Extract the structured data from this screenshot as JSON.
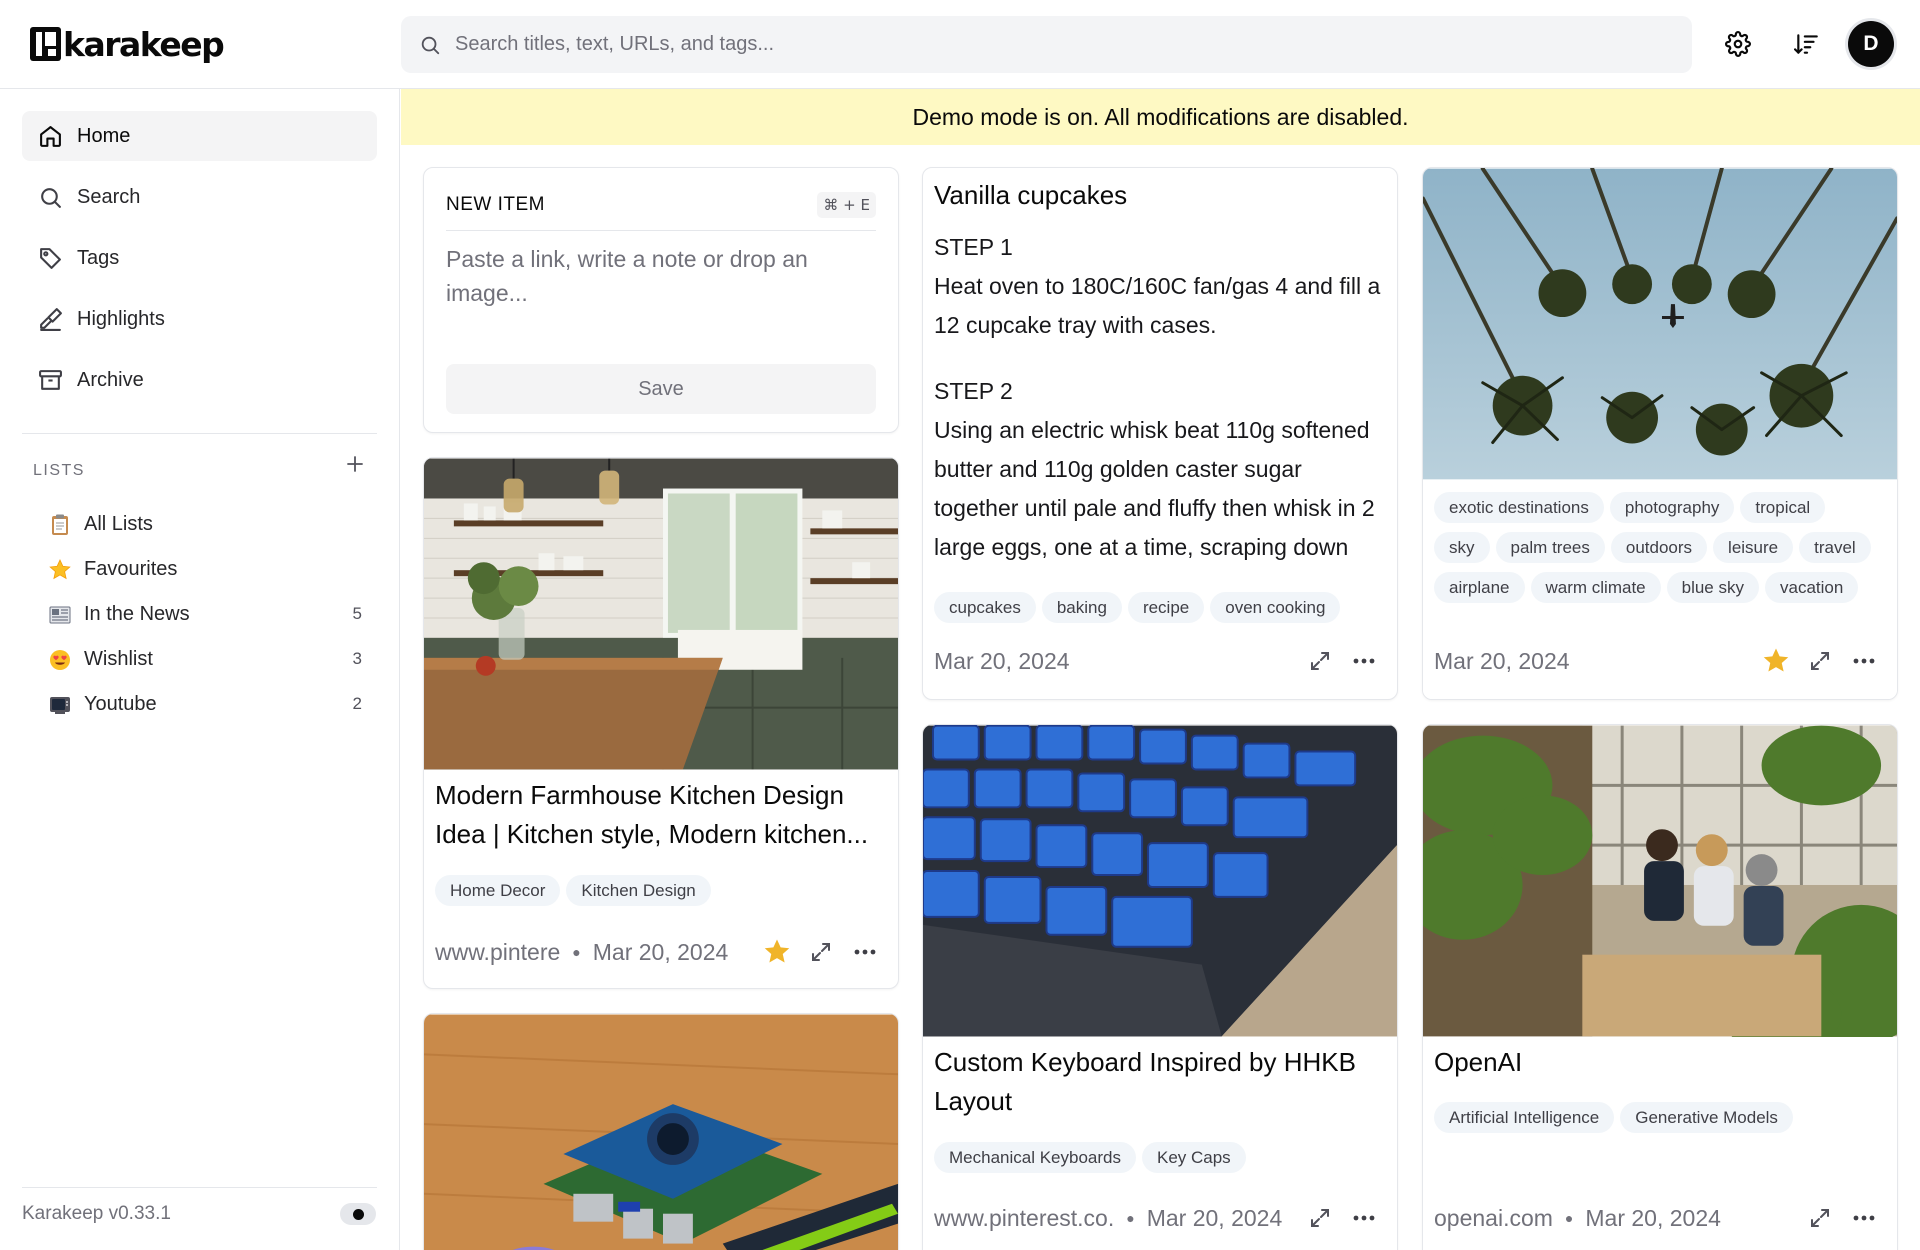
{
  "app": {
    "name": "karakeep"
  },
  "search": {
    "placeholder": "Search titles, text, URLs, and tags..."
  },
  "header": {
    "avatar_initial": "D"
  },
  "sidebar": {
    "nav": [
      {
        "label": "Home",
        "icon": "home-icon",
        "active": true
      },
      {
        "label": "Search",
        "icon": "search-icon"
      },
      {
        "label": "Tags",
        "icon": "tag-icon"
      },
      {
        "label": "Highlights",
        "icon": "highlighter-icon"
      },
      {
        "label": "Archive",
        "icon": "archive-icon"
      }
    ],
    "lists_heading": "LISTS",
    "lists": [
      {
        "emoji": "📋",
        "label": "All Lists",
        "count": ""
      },
      {
        "emoji": "⭐",
        "label": "Favourites",
        "count": ""
      },
      {
        "emoji": "📰",
        "label": "In the News",
        "count": "5"
      },
      {
        "emoji": "😍",
        "label": "Wishlist",
        "count": "3"
      },
      {
        "emoji": "📺",
        "label": "Youtube",
        "count": "2"
      }
    ],
    "version": "Karakeep v0.33.1"
  },
  "banner": {
    "text": "Demo mode is on. All modifications are disabled."
  },
  "new_item": {
    "heading": "NEW ITEM",
    "shortcut": "⌘ + E",
    "placeholder": "Paste a link, write a note or drop an image...",
    "save_label": "Save"
  },
  "cards": {
    "note": {
      "title": "Vanilla cupcakes",
      "step1_heading": "STEP 1",
      "step1_text": "Heat oven to 180C/160C fan/gas 4 and fill a 12 cupcake tray with cases.",
      "step2_heading": "STEP 2",
      "step2_text": "Using an electric whisk beat 110g softened butter and 110g golden caster sugar together until pale and fluffy then whisk in 2 large eggs, one at a time, scraping down",
      "tags": [
        "cupcakes",
        "baking",
        "recipe",
        "oven cooking"
      ],
      "date": "Mar 20, 2024"
    },
    "palms": {
      "tags": [
        "exotic destinations",
        "photography",
        "tropical",
        "sky",
        "palm trees",
        "outdoors",
        "leisure",
        "travel",
        "airplane",
        "warm climate",
        "blue sky",
        "vacation"
      ],
      "date": "Mar 20, 2024",
      "favourited": true
    },
    "kitchen": {
      "title": "Modern Farmhouse Kitchen Design Idea | Kitchen style, Modern kitchen...",
      "tags": [
        "Home Decor",
        "Kitchen Design"
      ],
      "source": "www.pintere",
      "date": "Mar 20, 2024",
      "favourited": true
    },
    "keyboard": {
      "title": "Custom Keyboard Inspired by HHKB Layout",
      "tags": [
        "Mechanical Keyboards",
        "Key Caps"
      ],
      "source": "www.pinterest.co.",
      "date": "Mar 20, 2024"
    },
    "openai": {
      "title": "OpenAI",
      "tags": [
        "Artificial Intelligence",
        "Generative Models"
      ],
      "source": "openai.com",
      "date": "Mar 20, 2024"
    }
  },
  "colors": {
    "banner": "#fef9c3",
    "star": "#f0b429",
    "tag_bg": "#f1f5f9"
  }
}
